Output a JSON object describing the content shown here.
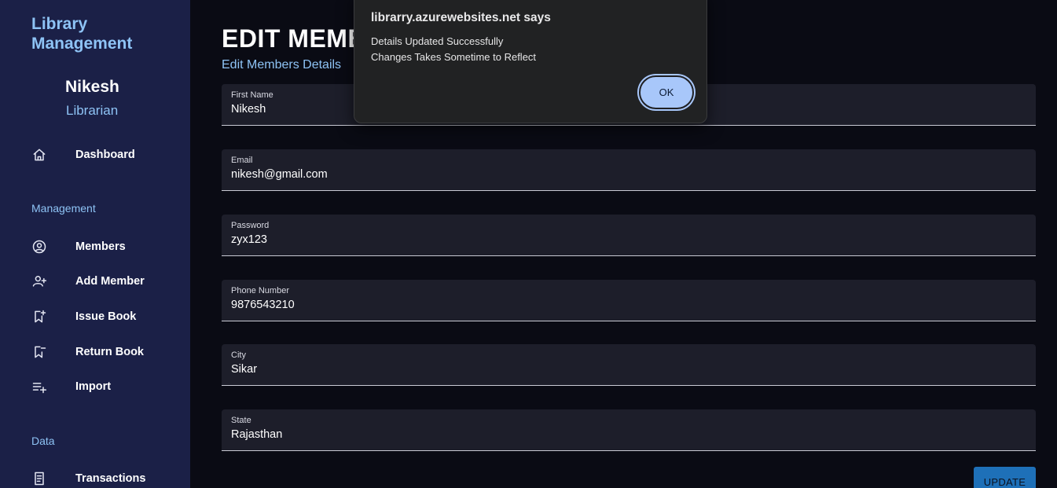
{
  "sidebar": {
    "brand": "Library Management",
    "profile": {
      "name": "Nikesh",
      "role": "Librarian"
    },
    "items": [
      {
        "label": "Dashboard",
        "icon": "home-icon"
      },
      {
        "label": "Members",
        "icon": "user-circle-icon"
      },
      {
        "label": "Add Member",
        "icon": "user-add-icon"
      },
      {
        "label": "Issue Book",
        "icon": "bookmark-add-icon"
      },
      {
        "label": "Return Book",
        "icon": "bookmark-return-icon"
      },
      {
        "label": "Import",
        "icon": "playlist-add-icon"
      },
      {
        "label": "Transactions",
        "icon": "receipt-icon"
      }
    ],
    "sections": {
      "management": "Management",
      "data": "Data"
    }
  },
  "main": {
    "title": "EDIT MEMBERS",
    "subtitle": "Edit Members Details",
    "fields": [
      {
        "label": "First Name",
        "value": "Nikesh"
      },
      {
        "label": "Email",
        "value": "nikesh@gmail.com"
      },
      {
        "label": "Password",
        "value": "zyx123"
      },
      {
        "label": "Phone Number",
        "value": "9876543210"
      },
      {
        "label": "City",
        "value": "Sikar"
      },
      {
        "label": "State",
        "value": "Rajasthan"
      }
    ],
    "update_label": "UPDATE"
  },
  "dialog": {
    "title": "librarry.azurewebsites.net says",
    "line1": "Details Updated Successfully",
    "line2": "Changes Takes Sometime to Reflect",
    "ok_label": "OK"
  },
  "colors": {
    "sidebar_bg": "#1b2047",
    "accent": "#8ec3f5",
    "page_bg": "#0a0b14",
    "button": "#1e70b8",
    "ok_button": "#a8c7fa"
  }
}
